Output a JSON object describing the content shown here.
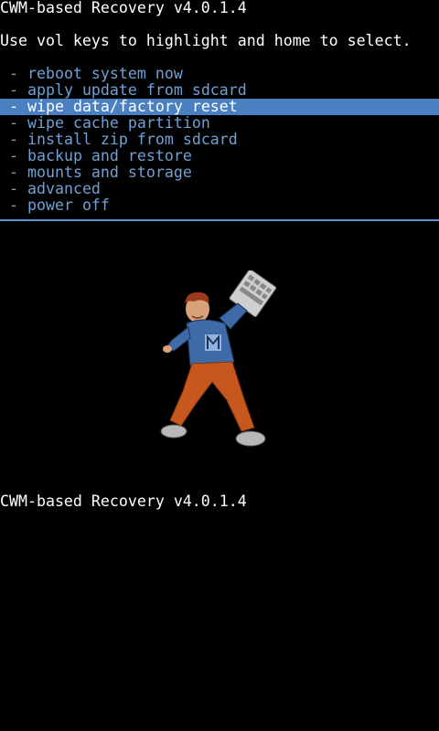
{
  "header": {
    "title": "CWM-based Recovery v4.0.1.4",
    "instructions": "Use vol keys to highlight and home to select."
  },
  "menu": {
    "bullet": "-",
    "items": [
      {
        "label": "reboot system now"
      },
      {
        "label": "apply update from sdcard"
      },
      {
        "label": "wipe data/factory reset",
        "selected": true
      },
      {
        "label": "wipe cache partition"
      },
      {
        "label": "install zip from sdcard"
      },
      {
        "label": "backup and restore"
      },
      {
        "label": "mounts and storage"
      },
      {
        "label": "advanced"
      },
      {
        "label": "power off"
      }
    ]
  },
  "footer": {
    "version": "CWM-based Recovery v4.0.1.4"
  },
  "mascot": {
    "icon": "andy-mascot-icon",
    "hoodie_logo": "M"
  },
  "colors": {
    "background": "#000000",
    "text": "#ffffff",
    "menu_text": "#6fa0d4",
    "highlight": "#4a7fc2",
    "separator": "#5b8fd0"
  }
}
